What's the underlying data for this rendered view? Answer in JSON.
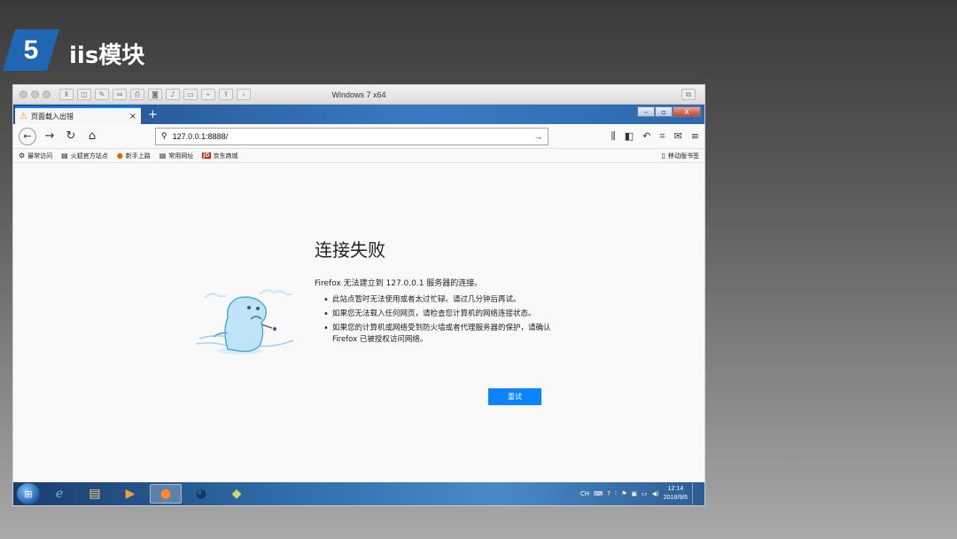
{
  "slide": {
    "number": "5",
    "title": "iis模块"
  },
  "vm": {
    "title": "Windows 7 x64",
    "toolbar_icons": [
      "pause-icon",
      "snapshot-icon",
      "wrench-icon",
      "arrows-icon",
      "printer-icon",
      "disk-icon",
      "speaker-icon",
      "camera-icon",
      "usb-icon",
      "share-icon",
      "chevron-left-icon"
    ]
  },
  "browser": {
    "tab": {
      "label": "页面载入出错",
      "close": "×"
    },
    "new_tab": "+",
    "window_controls": {
      "minimize": "–",
      "maximize": "▫",
      "close": "X"
    },
    "url": "127.0.0.1:8888/",
    "bookmarks": [
      {
        "icon": "gear-icon",
        "label": "最常访问"
      },
      {
        "icon": "folder-icon",
        "label": "火狐官方站点"
      },
      {
        "icon": "firefox-icon",
        "label": "新手上路"
      },
      {
        "icon": "folder-icon",
        "label": "常用网址"
      },
      {
        "icon": "jd-icon",
        "label": "京东商城"
      }
    ],
    "mobile_bookmarks": "移动版书签",
    "error": {
      "title": "连接失败",
      "description": "Firefox 无法建立到 127.0.0.1 服务器的连接。",
      "items": [
        "此站点暂时无法使用或者太过忙碌。请过几分钟后再试。",
        "如果您无法载入任何网页，请检查您计算机的网络连接状态。",
        "如果您的计算机或网络受到防火墙或者代理服务器的保护，请确认 Firefox 已被授权访问网络。"
      ],
      "retry": "重试"
    }
  },
  "taskbar": {
    "apps": [
      "internet-explorer-icon",
      "file-explorer-icon",
      "media-player-icon",
      "firefox-icon",
      "app-icon",
      "app2-icon"
    ],
    "tray": {
      "lang": "CH",
      "time": "12:14",
      "date": "2018/9/6"
    }
  },
  "colors": {
    "accent": "#0a84ff",
    "slide_badge": "#1f66b3"
  }
}
